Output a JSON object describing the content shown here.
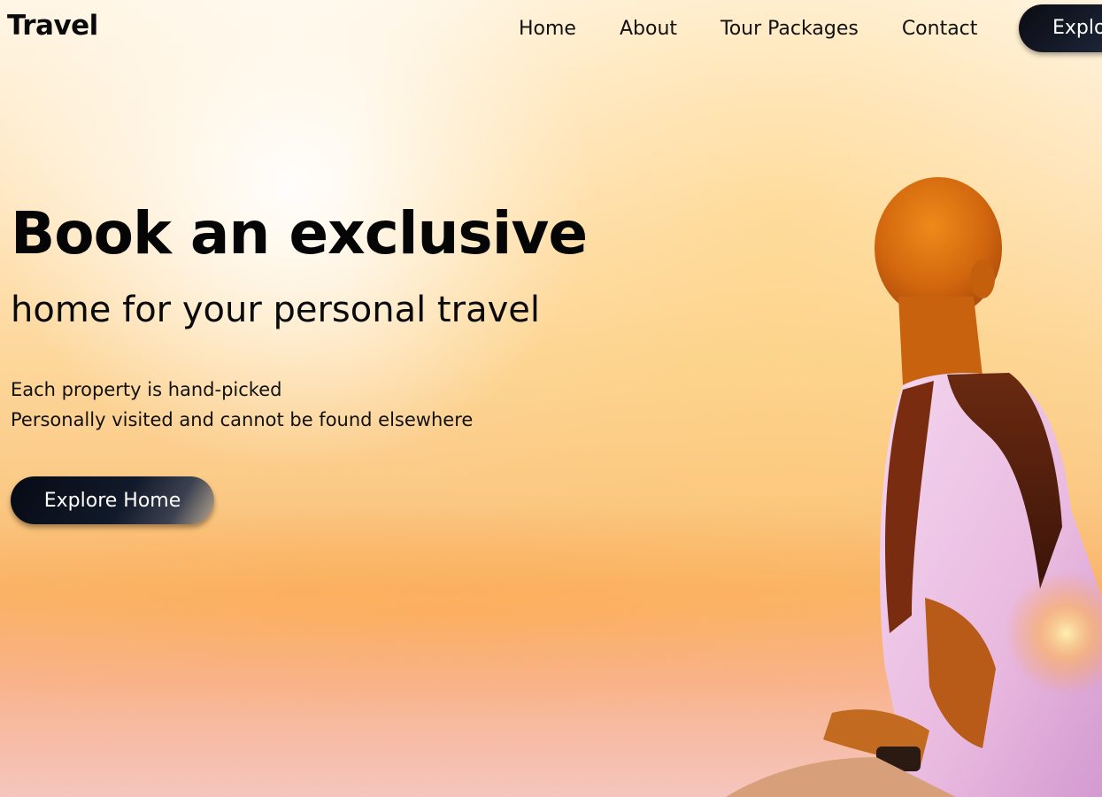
{
  "header": {
    "logo": "Travel",
    "nav": [
      {
        "label": "Home"
      },
      {
        "label": "About"
      },
      {
        "label": "Tour Packages"
      },
      {
        "label": "Contact"
      }
    ],
    "cta_label": "Explore"
  },
  "hero": {
    "title": "Book an exclusive",
    "subtitle": "home for your personal travel",
    "description_lines": [
      "Each property is hand-picked",
      "Personally visited and cannot be found elsewhere"
    ],
    "button_label": "Explore Home"
  },
  "colors": {
    "button_dark": "#0b0f1a",
    "sky_light": "#fff6e6",
    "sky_warm": "#fbc985",
    "horizon": "#f7b58a"
  }
}
